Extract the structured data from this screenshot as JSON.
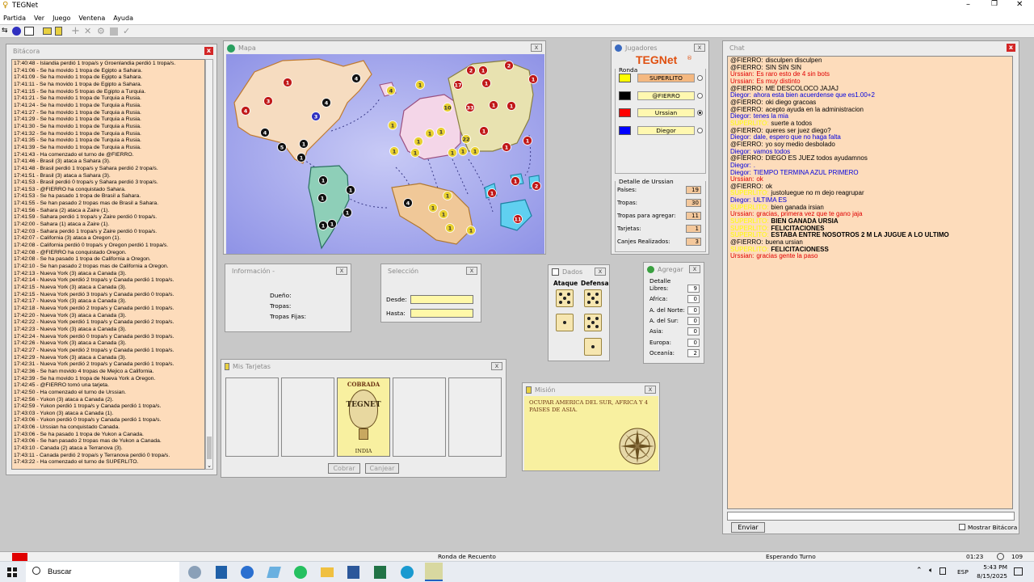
{
  "app": {
    "title": "TEGNet",
    "menu": [
      "Partida",
      "Ver",
      "Juego",
      "Ventena",
      "Ayuda"
    ]
  },
  "bitacora": {
    "title": "Bitácora",
    "lines": [
      "17:40:48 - Islandia perdió 1 tropa/s y Groenlandia perdió 1 tropa/s.",
      "17:41:06 - Se ha movido 1 tropa de Egipto a Sahara.",
      "17:41:09 - Se ha movido 1 tropa de Egipto a Sahara.",
      "17:41:11 - Se ha movido 1 tropa de Egipto a Sahara.",
      "17:41:15 - Se ha movido 5 tropas de Egipto a Turquia.",
      "17:41:21 - Se ha movido 1 tropa de Turquia a Rusia.",
      "17:41:24 - Se ha movido 1 tropa de Turquia a Rusia.",
      "17:41:27 - Se ha movido 1 tropa de Turquia a Rusia.",
      "17:41:29 - Se ha movido 1 tropa de Turquia a Rusia.",
      "17:41:30 - Se ha movido 1 tropa de Turquia a Rusia.",
      "17:41:32 - Se ha movido 1 tropa de Turquia a Rusia.",
      "17:41:35 - Se ha movido 1 tropa de Turquia a Rusia.",
      "17:41:39 - Se ha movido 1 tropa de Turquia a Rusia.",
      "17:41:43 - Ha comenzado el turno de @FIERRO.",
      "17:41:46 - Brasil (3) ataca a Sahara (3).",
      "17:41:48 - Brasil perdió 1 tropa/s y Sahara perdió 2 tropa/s.",
      "17:41:51 - Brasil (3) ataca a Sahara (3).",
      "17:41:53 - Brasil perdió 0 tropa/s y Sahara perdió 3 tropa/s.",
      "17:41:53 - @FIERRO ha conquistado Sahara.",
      "17:41:53 - Se ha pasado 1 tropa de Brasil a Sahara.",
      "17:41:55 - Se han pasado 2 tropas mas de Brasil a Sahara.",
      "17:41:56 - Sahara (2) ataca a Zaire (1).",
      "17:41:59 - Sahara perdió 1 tropa/s y Zaire perdió 0 tropa/s.",
      "17:42:00 - Sahara (1) ataca a Zaire (1).",
      "17:42:03 - Sahara perdió 1 tropa/s y Zaire perdió 0 tropa/s.",
      "17:42:07 - California (3) ataca a Oregon (1).",
      "17:42:08 - California perdió 0 tropa/s y Oregon perdió 1 tropa/s.",
      "17:42:08 - @FIERRO ha conquistado Oregon.",
      "17:42:08 - Se ha pasado 1 tropa de California a Oregon.",
      "17:42:10 - Se han pasado 2 tropas mas de California a Oregon.",
      "17:42:13 - Nueva York (3) ataca a Canada (3).",
      "17:42:14 - Nueva York perdió 2 tropa/s y Canada perdió 1 tropa/s.",
      "17:42:15 - Nueva York (3) ataca a Canada (3).",
      "17:42:15 - Nueva York perdió 3 tropa/s y Canada perdió 0 tropa/s.",
      "17:42:17 - Nueva York (3) ataca a Canada (3).",
      "17:42:18 - Nueva York perdió 2 tropa/s y Canada perdió 1 tropa/s.",
      "17:42:20 - Nueva York (3) ataca a Canada (3).",
      "17:42:22 - Nueva York perdió 1 tropa/s y Canada perdió 2 tropa/s.",
      "17:42:23 - Nueva York (3) ataca a Canada (3).",
      "17:42:24 - Nueva York perdió 0 tropa/s y Canada perdió 3 tropa/s.",
      "17:42:26 - Nueva York (3) ataca a Canada (3).",
      "17:42:27 - Nueva York perdió 2 tropa/s y Canada perdió 1 tropa/s.",
      "17:42:29 - Nueva York (3) ataca a Canada (3).",
      "17:42:31 - Nueva York perdió 2 tropa/s y Canada perdió 1 tropa/s.",
      "17:42:36 - Se han movido 4 tropas de Mejico a California.",
      "17:42:39 - Se ha movido 1 tropa de Nueva York a Oregon.",
      "17:42:45 - @FIERRO tomó una tarjeta.",
      "17:42:50 - Ha comenzado el turno de Urssian.",
      "17:42:56 - Yukon (3) ataca a Canada (2).",
      "17:42:59 - Yukon perdió 1 tropa/s y Canada perdió 1 tropa/s.",
      "17:43:03 - Yukon (3) ataca a Canada (1).",
      "17:43:06 - Yukon perdió 0 tropa/s y Canada perdió 1 tropa/s.",
      "17:43:06 - Urssian ha conquistado Canada.",
      "17:43:06 - Se ha pasado 1 tropa de Yukon a Canada.",
      "17:43:06 - Se han pasado 2 tropas mas de Yukon a Canada.",
      "17:43:10 - Canada (2) ataca a Terranova (3).",
      "17:43:11 - Canada perdió 2 tropa/s y Terranova perdió 0 tropa/s.",
      "17:43:22 - Ha comenzado el turno de SUPERLITO."
    ]
  },
  "mapa": {
    "title": "Mapa"
  },
  "informacion": {
    "title": "Información -",
    "dueno": "Dueño:",
    "tropas": "Tropas:",
    "tropas_fijas": "Tropas Fijas:"
  },
  "seleccion": {
    "title": "Selección",
    "desde": "Desde:",
    "hasta": "Hasta:"
  },
  "dados": {
    "title": "Dados",
    "ataque": "Ataque",
    "defensa": "Defensa"
  },
  "agregar": {
    "title": "Agregar",
    "detalle": "Detalle",
    "rows": [
      {
        "label": "Libres:",
        "value": "9"
      },
      {
        "label": "Africa:",
        "value": "0"
      },
      {
        "label": "A. del Norte:",
        "value": "0"
      },
      {
        "label": "A. del Sur:",
        "value": "0"
      },
      {
        "label": "Asia:",
        "value": "0"
      },
      {
        "label": "Europa:",
        "value": "0"
      },
      {
        "label": "Oceanía:",
        "value": "2"
      }
    ]
  },
  "tarjetas": {
    "title": "Mis Tarjetas",
    "card_top": "COBRADA",
    "card_logo": "TEGNET",
    "card_country": "INDIA",
    "cobrar": "Cobrar",
    "canjear": "Canjear"
  },
  "mision": {
    "title": "Misión",
    "text": "OCUPAR AMERICA DEL SUR, AFRICA Y 4 PAISES DE ASIA."
  },
  "jugadores": {
    "title": "Jugadores",
    "logo": "TEGNet",
    "reg": "®",
    "ronda": "Ronda",
    "players": [
      {
        "name": "SUPERLITO",
        "color": "#ffff00",
        "active": true
      },
      {
        "name": "@FIERRO",
        "color": "#000000",
        "active": false
      },
      {
        "name": "Urssian",
        "color": "#ff0000",
        "active": false
      },
      {
        "name": "Diegor",
        "color": "#0000ff",
        "active": false
      }
    ],
    "detalle_title": "Detalle de Urssian",
    "detalle": [
      {
        "label": "Países:",
        "value": "19"
      },
      {
        "label": "Tropas:",
        "value": "30"
      },
      {
        "label": "Tropas para agregar:",
        "value": "11"
      },
      {
        "label": "Tarjetas:",
        "value": "1"
      },
      {
        "label": "Canjes Realizados:",
        "value": "3"
      }
    ]
  },
  "chat": {
    "title": "Chat",
    "messages": [
      {
        "nick": "@FIERRO",
        "text": "disculpen disculpen",
        "color": "#000000"
      },
      {
        "nick": "@FIERRO",
        "text": "SIN SIN SIN",
        "color": "#000000"
      },
      {
        "nick": "Urssian",
        "text": "Es raro esto de 4 sin bots",
        "color": "#e00000"
      },
      {
        "nick": "Urssian",
        "text": "Es muy distinto",
        "color": "#e00000"
      },
      {
        "nick": "@FIERRO",
        "text": "ME DESCOLOCO JAJAJ",
        "color": "#000000"
      },
      {
        "nick": "Diegor",
        "text": "ahora esta bien acuerdense que es1.00+2",
        "color": "#0000e0"
      },
      {
        "nick": "@FIERRO",
        "text": "oki diego gracoas",
        "color": "#000000"
      },
      {
        "nick": "@FIERRO",
        "text": "acepto ayuda en la administracion",
        "color": "#000000"
      },
      {
        "nick": "Diegor",
        "text": "tenes la mia",
        "color": "#0000e0"
      },
      {
        "nick": "SUPERLITO",
        "text": "suerte a todos",
        "color": "#ffff00"
      },
      {
        "nick": "@FIERRO",
        "text": "queres ser juez diego?",
        "color": "#000000"
      },
      {
        "nick": "Diegor",
        "text": "dale, espero que no haga falta",
        "color": "#0000e0"
      },
      {
        "nick": "@FIERRO",
        "text": "yo soy medio desbolado",
        "color": "#000000"
      },
      {
        "nick": "Diegor",
        "text": "vamos todos",
        "color": "#0000e0"
      },
      {
        "nick": "@FIERRO",
        "text": "DIEGO ES JUEZ todos ayudamnos",
        "color": "#000000"
      },
      {
        "nick": "Diegor",
        "text": ".",
        "color": "#0000e0"
      },
      {
        "nick": "Diegor",
        "text": "TIEMPO TERMINA AZUL PRIMERO",
        "color": "#0000e0"
      },
      {
        "nick": "Urssian",
        "text": "ok",
        "color": "#e00000"
      },
      {
        "nick": "@FIERRO",
        "text": "ok",
        "color": "#000000"
      },
      {
        "nick": "SUPERLITO",
        "text": "justoluegue no m dejo reagrupar",
        "color": "#ffff00"
      },
      {
        "nick": "Diegor",
        "text": "ULTIMA ES",
        "color": "#0000e0"
      },
      {
        "nick": "SUPERLITO",
        "text": "bien ganada irsian",
        "color": "#ffff00"
      },
      {
        "nick": "Urssian",
        "text": "gracias, primera vez que te gano jaja",
        "color": "#e00000"
      },
      {
        "nick": "SUPERLITO",
        "text": "BIEN GANADA URSIA",
        "color": "#ffff00"
      },
      {
        "nick": "SUPERLITO",
        "text": "FELICITACIONES",
        "color": "#ffff00"
      },
      {
        "nick": "SUPERLITO",
        "text": "ESTABA ENTRE NOSOTROS 2 M LA JUGUE A LO ULTIMO",
        "color": "#ffff00"
      },
      {
        "nick": "@FIERRO",
        "text": "buena ursian",
        "color": "#000000"
      },
      {
        "nick": "SUPERLITO",
        "text": "FELICITACIONESS",
        "color": "#ffff00"
      },
      {
        "nick": "Urssian",
        "text": "gracias gente la paso",
        "color": "#e00000"
      }
    ],
    "enviar": "Enviar",
    "mostrar": "Mostrar Bitácora"
  },
  "status": {
    "ronda": "Ronda de Recuento",
    "esperando": "Esperando Turno",
    "time": "01:23",
    "count": "109"
  },
  "taskbar": {
    "search": "Buscar",
    "lang": "ESP",
    "time": "5:43 PM",
    "date": "8/15/2025"
  }
}
